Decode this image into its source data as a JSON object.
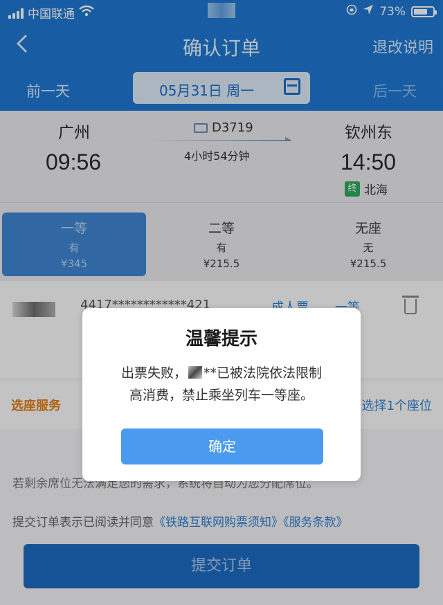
{
  "status_bar": {
    "carrier": "中国联通",
    "battery": "73%",
    "battery_level": 0.73
  },
  "header": {
    "title": "确认订单",
    "right_link": "退改说明"
  },
  "date_bar": {
    "prev": "前一天",
    "date": "05月31日 周一",
    "next": "后一天"
  },
  "train": {
    "from_station": "广州",
    "to_station": "钦州东",
    "departure_time": "09:56",
    "arrival_time": "14:50",
    "train_number": "D3719",
    "duration": "4小时54分钟",
    "terminal_badge": "终",
    "terminal_station": "北海"
  },
  "seats": [
    {
      "name": "一等",
      "availability": "有",
      "price": "¥345"
    },
    {
      "name": "二等",
      "availability": "有",
      "price": "¥215.5"
    },
    {
      "name": "无座",
      "availability": "无",
      "price": "¥215.5"
    }
  ],
  "passenger": {
    "id_number": "4417************421",
    "ticket_type": "成人票",
    "seat_class": "一等"
  },
  "seat_service": {
    "label": "选座服务",
    "action": "选择1个座位"
  },
  "notice": "若剩余席位无法满足您的需求，系统将自动为您分配席位。",
  "agreement": {
    "prefix": "提交订单表示已阅读并同意",
    "link": "《铁路互联网购票须知》《服务条款》"
  },
  "submit_label": "提交订单",
  "dialog": {
    "title": "温馨提示",
    "message_part1": "出票失败，",
    "message_part2": "**已被法院依法限制",
    "message_line2": "高消费，禁止乘坐列车一等座。",
    "confirm_label": "确定"
  }
}
